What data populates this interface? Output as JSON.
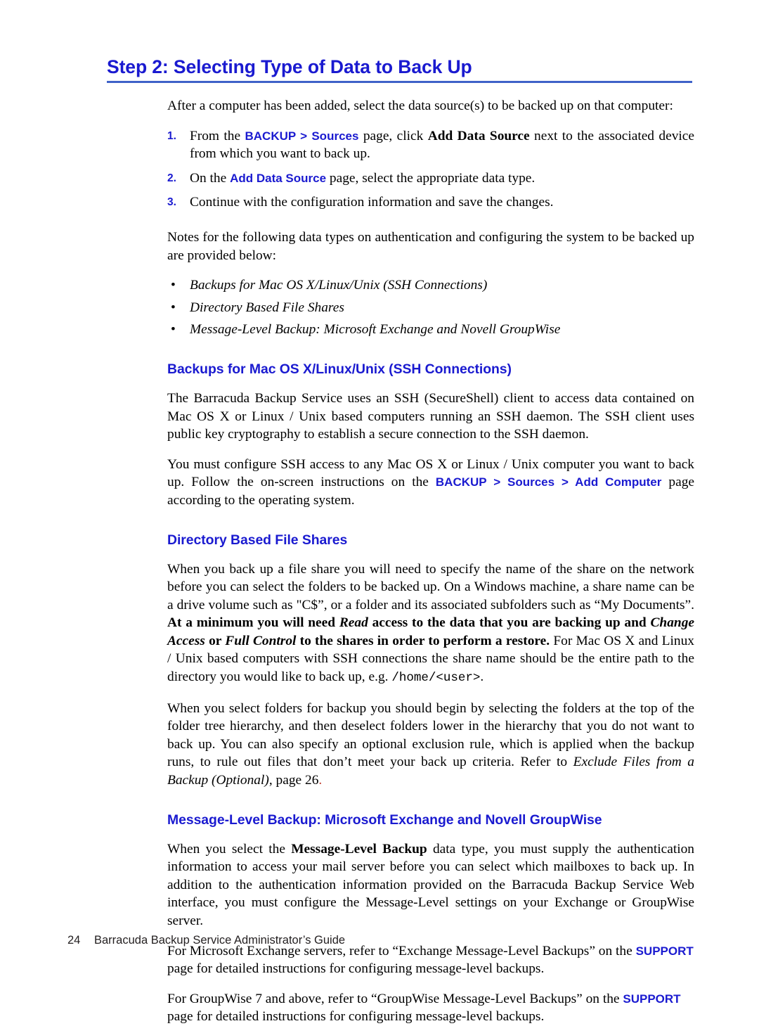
{
  "colors": {
    "heading_blue": "#1a1ad0",
    "rule_blue": "#3f62c8",
    "body_black": "#000000",
    "footer_gray": "#231f20",
    "red_accent": "#c0392b"
  },
  "banner": {
    "title": "Step 2: Selecting Type of Data to Back Up"
  },
  "intro": {
    "paragraph": "After a computer has been added, select the data source(s) to be backed up on that computer:"
  },
  "numbered_steps": [
    {
      "marker": "1.",
      "seg_1": "From the ",
      "ui_1": "BACKUP > Sources",
      "seg_2": " page, click ",
      "bold_1": "Add Data Source",
      "seg_3": " next to the associated device from which you want to back up."
    },
    {
      "marker": "2.",
      "seg_1": "On the ",
      "ui_1": "Add Data Source",
      "seg_2": " page, select the appropriate data type.",
      "bold_1": "",
      "seg_3": ""
    },
    {
      "marker": "3.",
      "seg_1": "Continue with the configuration information and save the changes.",
      "ui_1": "",
      "seg_2": "",
      "bold_1": "",
      "seg_3": ""
    }
  ],
  "notes": {
    "lead_paragraph": "Notes for the following data types on authentication and configuring the system to be backed up are provided below:",
    "bullet_marker": "•",
    "items": [
      "Backups for Mac OS X/Linux/Unix (SSH Connections)",
      "Directory Based File Shares",
      "Message-Level Backup: Microsoft Exchange and Novell GroupWise"
    ]
  },
  "section_ssh": {
    "heading": "Backups for Mac OS X/Linux/Unix (SSH Connections)",
    "paragraph_1": "The Barracuda Backup Service uses an SSH (SecureShell) client to access data contained on Mac OS X or Linux / Unix based computers running an SSH daemon. The SSH client uses public key cryptography to establish a secure connection to the SSH daemon.",
    "p2_seg_1": "You must configure SSH access to any Mac OS X or Linux / Unix computer you want to back up. Follow the on-screen instructions on the ",
    "p2_ui": "BACKUP > Sources > Add Computer",
    "p2_seg_2": " page according to the operating system."
  },
  "section_shares": {
    "heading": "Directory Based File Shares",
    "p1_seg_1": "When you back up a file share you will need to specify the name of the share on the network before you can select the folders to be backed up. On a Windows machine, a share name can be a drive volume such as \"C$”, or a folder and its associated subfolders such as “My Documents”. ",
    "p1_bold_1": "At a minimum you will need ",
    "p1_bolditalic_1": "Read",
    "p1_bold_2": " access to the data that you are backing up and ",
    "p1_bolditalic_2": "Change Access",
    "p1_bold_3": " or ",
    "p1_bolditalic_3": "Full Control",
    "p1_bold_4": " to the shares in order to perform a restore.",
    "p1_seg_2": " For Mac OS X and Linux / Unix based computers with SSH connections the share name should be the entire path to the directory you would like to back up, e.g. ",
    "p1_mono": "/home/<user>",
    "p1_seg_3": ".",
    "p2_seg_1": "When you select folders for backup you should begin by selecting the folders at the top of the folder tree hierarchy, and then deselect folders lower in the hierarchy that you do not want to back up. You can also specify an optional exclusion rule, which is applied when the backup runs, to rule out files that don’t meet your back up criteria. Refer to ",
    "p2_italic": "Exclude Files from a Backup (Optional)",
    "p2_seg_2": ", page 26",
    "p2_period": "."
  },
  "section_message": {
    "heading": "Message-Level Backup: Microsoft Exchange and Novell GroupWise",
    "p1_seg_1": "When you select the ",
    "p1_bold": "Message-Level Backup",
    "p1_seg_2": " data type, you must supply the authentication information to access your mail server before you can select which mailboxes to back up. In addition to the authentication information provided on the Barracuda Backup Service Web interface, you must configure the Message-Level settings on your Exchange or GroupWise server.",
    "p2_seg_1": "For Microsoft Exchange servers, refer to “Exchange Message-Level Backups” on the ",
    "p2_ui": "SUPPORT",
    "p2_seg_2": " page for detailed instructions for configuring message-level backups.",
    "p3_seg_1": "For GroupWise 7 and above, refer to “GroupWise Message-Level Backups” on the ",
    "p3_ui": "SUPPORT",
    "p3_seg_2": " page for detailed instructions for configuring message-level backups."
  },
  "footer": {
    "page_number": "24",
    "document_title": "Barracuda Backup Service Administrator’s Guide"
  }
}
